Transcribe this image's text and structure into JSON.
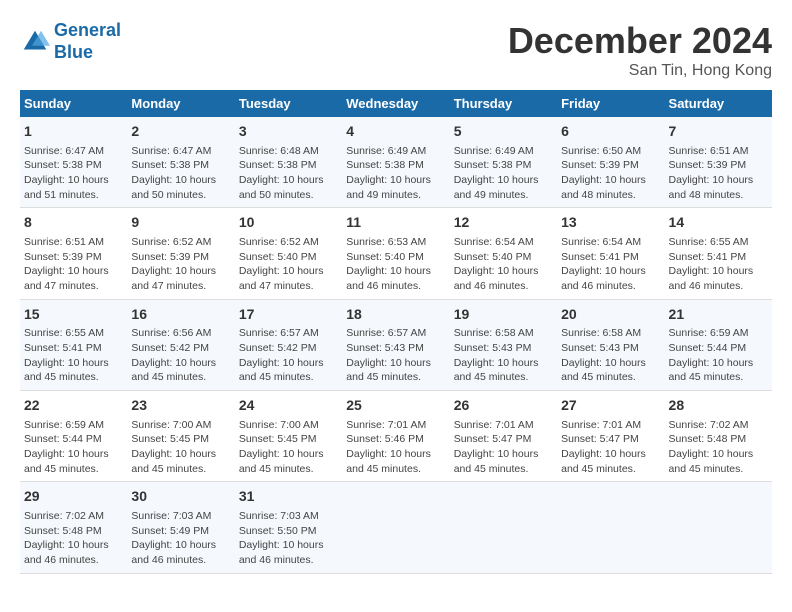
{
  "header": {
    "logo_line1": "General",
    "logo_line2": "Blue",
    "month": "December 2024",
    "location": "San Tin, Hong Kong"
  },
  "days_of_week": [
    "Sunday",
    "Monday",
    "Tuesday",
    "Wednesday",
    "Thursday",
    "Friday",
    "Saturday"
  ],
  "weeks": [
    [
      {
        "day": "1",
        "info": "Sunrise: 6:47 AM\nSunset: 5:38 PM\nDaylight: 10 hours\nand 51 minutes."
      },
      {
        "day": "2",
        "info": "Sunrise: 6:47 AM\nSunset: 5:38 PM\nDaylight: 10 hours\nand 50 minutes."
      },
      {
        "day": "3",
        "info": "Sunrise: 6:48 AM\nSunset: 5:38 PM\nDaylight: 10 hours\nand 50 minutes."
      },
      {
        "day": "4",
        "info": "Sunrise: 6:49 AM\nSunset: 5:38 PM\nDaylight: 10 hours\nand 49 minutes."
      },
      {
        "day": "5",
        "info": "Sunrise: 6:49 AM\nSunset: 5:38 PM\nDaylight: 10 hours\nand 49 minutes."
      },
      {
        "day": "6",
        "info": "Sunrise: 6:50 AM\nSunset: 5:39 PM\nDaylight: 10 hours\nand 48 minutes."
      },
      {
        "day": "7",
        "info": "Sunrise: 6:51 AM\nSunset: 5:39 PM\nDaylight: 10 hours\nand 48 minutes."
      }
    ],
    [
      {
        "day": "8",
        "info": "Sunrise: 6:51 AM\nSunset: 5:39 PM\nDaylight: 10 hours\nand 47 minutes."
      },
      {
        "day": "9",
        "info": "Sunrise: 6:52 AM\nSunset: 5:39 PM\nDaylight: 10 hours\nand 47 minutes."
      },
      {
        "day": "10",
        "info": "Sunrise: 6:52 AM\nSunset: 5:40 PM\nDaylight: 10 hours\nand 47 minutes."
      },
      {
        "day": "11",
        "info": "Sunrise: 6:53 AM\nSunset: 5:40 PM\nDaylight: 10 hours\nand 46 minutes."
      },
      {
        "day": "12",
        "info": "Sunrise: 6:54 AM\nSunset: 5:40 PM\nDaylight: 10 hours\nand 46 minutes."
      },
      {
        "day": "13",
        "info": "Sunrise: 6:54 AM\nSunset: 5:41 PM\nDaylight: 10 hours\nand 46 minutes."
      },
      {
        "day": "14",
        "info": "Sunrise: 6:55 AM\nSunset: 5:41 PM\nDaylight: 10 hours\nand 46 minutes."
      }
    ],
    [
      {
        "day": "15",
        "info": "Sunrise: 6:55 AM\nSunset: 5:41 PM\nDaylight: 10 hours\nand 45 minutes."
      },
      {
        "day": "16",
        "info": "Sunrise: 6:56 AM\nSunset: 5:42 PM\nDaylight: 10 hours\nand 45 minutes."
      },
      {
        "day": "17",
        "info": "Sunrise: 6:57 AM\nSunset: 5:42 PM\nDaylight: 10 hours\nand 45 minutes."
      },
      {
        "day": "18",
        "info": "Sunrise: 6:57 AM\nSunset: 5:43 PM\nDaylight: 10 hours\nand 45 minutes."
      },
      {
        "day": "19",
        "info": "Sunrise: 6:58 AM\nSunset: 5:43 PM\nDaylight: 10 hours\nand 45 minutes."
      },
      {
        "day": "20",
        "info": "Sunrise: 6:58 AM\nSunset: 5:43 PM\nDaylight: 10 hours\nand 45 minutes."
      },
      {
        "day": "21",
        "info": "Sunrise: 6:59 AM\nSunset: 5:44 PM\nDaylight: 10 hours\nand 45 minutes."
      }
    ],
    [
      {
        "day": "22",
        "info": "Sunrise: 6:59 AM\nSunset: 5:44 PM\nDaylight: 10 hours\nand 45 minutes."
      },
      {
        "day": "23",
        "info": "Sunrise: 7:00 AM\nSunset: 5:45 PM\nDaylight: 10 hours\nand 45 minutes."
      },
      {
        "day": "24",
        "info": "Sunrise: 7:00 AM\nSunset: 5:45 PM\nDaylight: 10 hours\nand 45 minutes."
      },
      {
        "day": "25",
        "info": "Sunrise: 7:01 AM\nSunset: 5:46 PM\nDaylight: 10 hours\nand 45 minutes."
      },
      {
        "day": "26",
        "info": "Sunrise: 7:01 AM\nSunset: 5:47 PM\nDaylight: 10 hours\nand 45 minutes."
      },
      {
        "day": "27",
        "info": "Sunrise: 7:01 AM\nSunset: 5:47 PM\nDaylight: 10 hours\nand 45 minutes."
      },
      {
        "day": "28",
        "info": "Sunrise: 7:02 AM\nSunset: 5:48 PM\nDaylight: 10 hours\nand 45 minutes."
      }
    ],
    [
      {
        "day": "29",
        "info": "Sunrise: 7:02 AM\nSunset: 5:48 PM\nDaylight: 10 hours\nand 46 minutes."
      },
      {
        "day": "30",
        "info": "Sunrise: 7:03 AM\nSunset: 5:49 PM\nDaylight: 10 hours\nand 46 minutes."
      },
      {
        "day": "31",
        "info": "Sunrise: 7:03 AM\nSunset: 5:50 PM\nDaylight: 10 hours\nand 46 minutes."
      },
      {
        "day": "",
        "info": ""
      },
      {
        "day": "",
        "info": ""
      },
      {
        "day": "",
        "info": ""
      },
      {
        "day": "",
        "info": ""
      }
    ]
  ]
}
